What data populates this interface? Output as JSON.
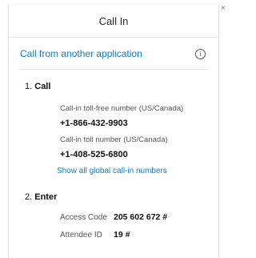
{
  "dialog": {
    "title": "Call In",
    "close_glyph": "×",
    "close_icon": "close-icon"
  },
  "app": {
    "link_label": "Call from another application",
    "info_glyph": "i",
    "info_icon": "info-icon"
  },
  "call_section": {
    "number": "1.",
    "title": "Call",
    "tollfree_label": "Call-in toll-free number (US/Canada)",
    "tollfree_number": "+1-866-432-9903",
    "toll_label": "Call-in toll number (US/Canada)",
    "toll_number": "+1-408-525-6800",
    "global_link": "Show all global call-in numbers"
  },
  "enter_section": {
    "number": "2.",
    "title": "Enter",
    "access_code_label": "Access Code",
    "access_code_value": "205 602 672 #",
    "attendee_id_label": "Attendee ID",
    "attendee_id_value": "19 #"
  },
  "colors": {
    "link": "#0a7ec2",
    "divider": "#e6e6e6",
    "text": "#111111",
    "muted": "#555555"
  }
}
